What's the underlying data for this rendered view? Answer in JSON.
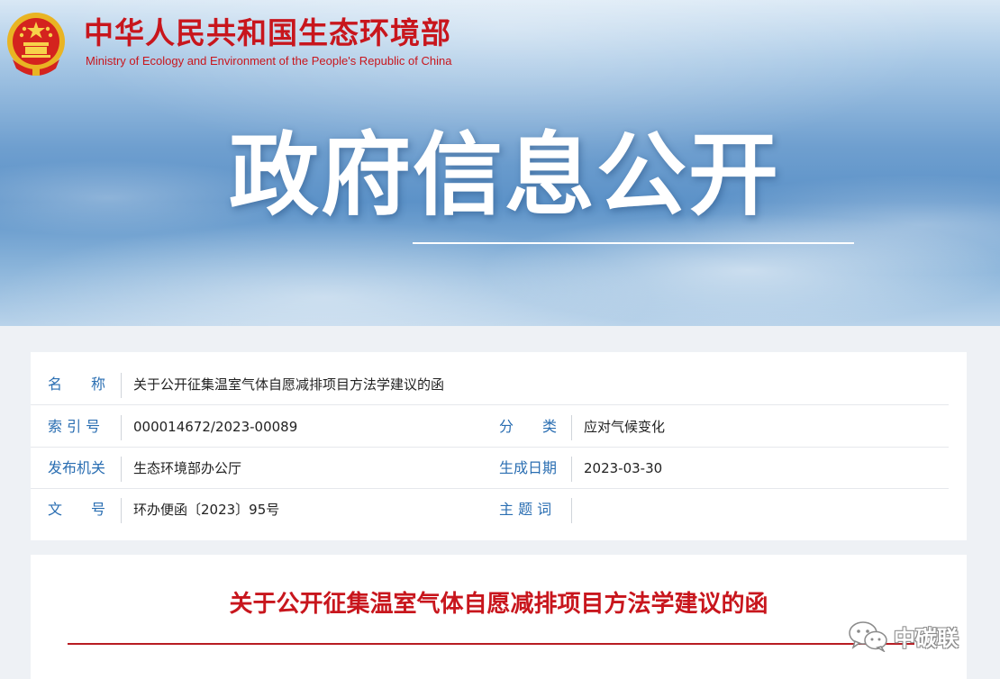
{
  "header": {
    "ministry_cn": "中华人民共和国生态环境部",
    "ministry_en": "Ministry of Ecology and Environment of the People's Republic of China",
    "emblem_icon": "national-emblem-icon",
    "banner_title": "政府信息公开"
  },
  "info": {
    "name_label": "名　　称",
    "name_value": "关于公开征集温室气体自愿减排项目方法学建议的函",
    "index_label": "索 引 号",
    "index_value": "000014672/2023-00089",
    "category_label": "分　　类",
    "category_value": "应对气候变化",
    "issuer_label": "发布机关",
    "issuer_value": "生态环境部办公厅",
    "date_label": "生成日期",
    "date_value": "2023-03-30",
    "docno_label": "文　　号",
    "docno_value": "环办便函〔2023〕95号",
    "keywords_label": "主 题 词",
    "keywords_value": ""
  },
  "content": {
    "doc_title": "关于公开征集温室气体自愿减排项目方法学建议的函"
  },
  "watermark": {
    "icon": "wechat-icon",
    "text": "中碳联"
  },
  "colors": {
    "brand_red": "#c8161d",
    "label_blue": "#2a6eb2",
    "text_dark": "#222222"
  }
}
